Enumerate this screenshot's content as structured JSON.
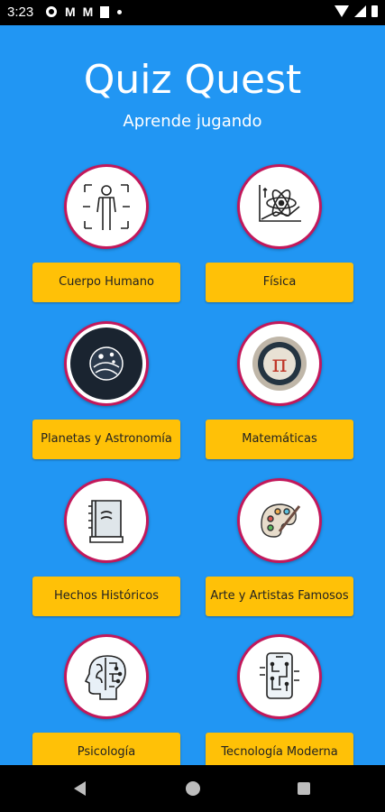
{
  "status_bar": {
    "time": "3:23"
  },
  "header": {
    "title": "Quiz Quest",
    "subtitle": "Aprende jugando"
  },
  "categories": [
    {
      "label": "Cuerpo Humano",
      "icon": "human-body-icon"
    },
    {
      "label": "Física",
      "icon": "atom-icon"
    },
    {
      "label": "Planetas y Astronomía",
      "icon": "planet-icon"
    },
    {
      "label": "Matemáticas",
      "icon": "pi-icon"
    },
    {
      "label": "Hechos Históricos",
      "icon": "history-book-icon"
    },
    {
      "label": "Arte y Artistas Famosos",
      "icon": "palette-icon"
    },
    {
      "label": "Psicología",
      "icon": "brain-head-icon"
    },
    {
      "label": "Tecnología Moderna",
      "icon": "smartphone-circuit-icon"
    }
  ],
  "colors": {
    "background": "#2196f3",
    "button": "#ffc107",
    "circle_border": "#c2185b"
  }
}
